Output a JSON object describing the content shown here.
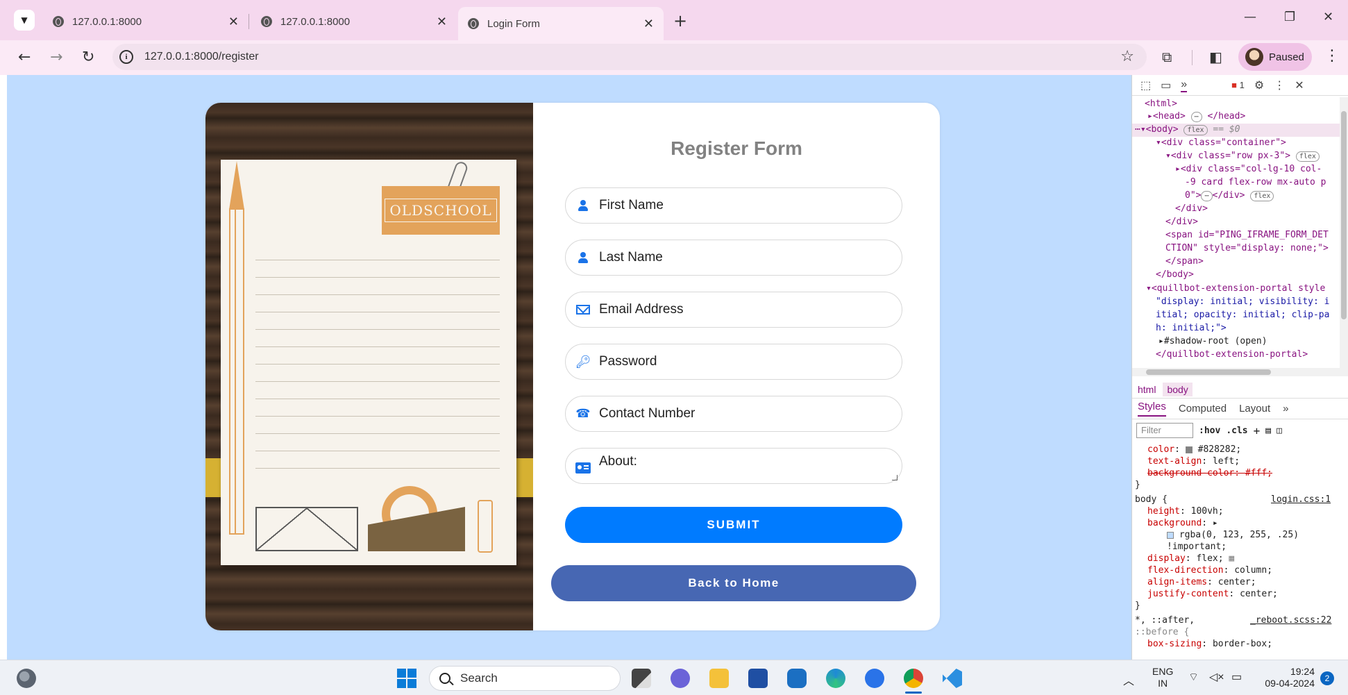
{
  "browser": {
    "tabs": [
      {
        "title": "127.0.0.1:8000",
        "active": false
      },
      {
        "title": "127.0.0.1:8000",
        "active": false
      },
      {
        "title": "Login Form",
        "active": true
      }
    ],
    "new_tab": "+",
    "tab_close": "✕",
    "window_controls": {
      "minimize": "—",
      "restore": "❐",
      "close": "✕"
    },
    "url": "127.0.0.1:8000/register",
    "profile_label": "Paused"
  },
  "page": {
    "notepad_label": "OLDSCHOOL",
    "form_title": "Register Form",
    "fields": {
      "first_name": "First Name",
      "last_name": "Last Name",
      "email": "Email Address",
      "password": "Password",
      "contact": "Contact Number",
      "about": "About:"
    },
    "submit_label": "SUBMIT",
    "home_label": "Back to Home"
  },
  "devtools": {
    "issues_count": "1",
    "crumbs": [
      "html",
      "body"
    ],
    "tabs": [
      "Styles",
      "Computed",
      "Layout"
    ],
    "filter_placeholder": "Filter",
    "hov": ":hov",
    "cls": ".cls",
    "tree": {
      "l1": "<html>",
      "l2": "<head>",
      "l2b": "</head>",
      "l3": "<body>",
      "l3_eq": "== $0",
      "l4": "<div class=\"container\">",
      "l5": "<div class=\"row px-3\">",
      "l6": "<div class=\"col-lg-10 col-",
      "l7": "-9 card flex-row mx-auto p",
      "l8": "0\">",
      "l8b": "</div>",
      "l9": "</div>",
      "l10": "</div>",
      "l11": "<span id=\"PING_IFRAME_FORM_DET",
      "l12": "CTION\" style=\"display: none;\">",
      "l13": "</span>",
      "l14": "</body>",
      "l15": "<quillbot-extension-portal style",
      "l16": "\"display: initial; visibility: i",
      "l17": "itial; opacity: initial; clip-pa",
      "l18": "h: initial;\">",
      "l19": "#shadow-root (open)",
      "l20": "</quillbot-extension-portal>",
      "badge_flex": "flex"
    },
    "styles": {
      "s1_prop": "color",
      "s1_val": "#828282;",
      "s2_prop": "text-align",
      "s2_val": "left;",
      "s3": "background-color: #fff;",
      "close": "}",
      "body_sel": "body {",
      "body_src": "login.css:1",
      "h_prop": "height",
      "h_val": "100vh;",
      "bg_prop": "background",
      "bg_val": "rgba(0, 123, 255, .25)",
      "important": "!important;",
      "d_prop": "display",
      "d_val": "flex;",
      "fd_prop": "flex-direction",
      "fd_val": "column;",
      "ai_prop": "align-items",
      "ai_val": "center;",
      "jc_prop": "justify-content",
      "jc_val": "center;",
      "univ_sel": "*, ::after,",
      "univ_src": "_reboot.scss:22",
      "before_sel": "::before {",
      "bs_prop": "box-sizing",
      "bs_val": "border-box;"
    }
  },
  "taskbar": {
    "search_label": "Search",
    "lang_top": "ENG",
    "lang_bottom": "IN",
    "time": "19:24",
    "date": "09-04-2024",
    "notification_count": "2"
  },
  "colors": {
    "page_bg": "#bfdcff",
    "submit": "#007bff",
    "home": "#4767b3",
    "title": "#828282"
  }
}
